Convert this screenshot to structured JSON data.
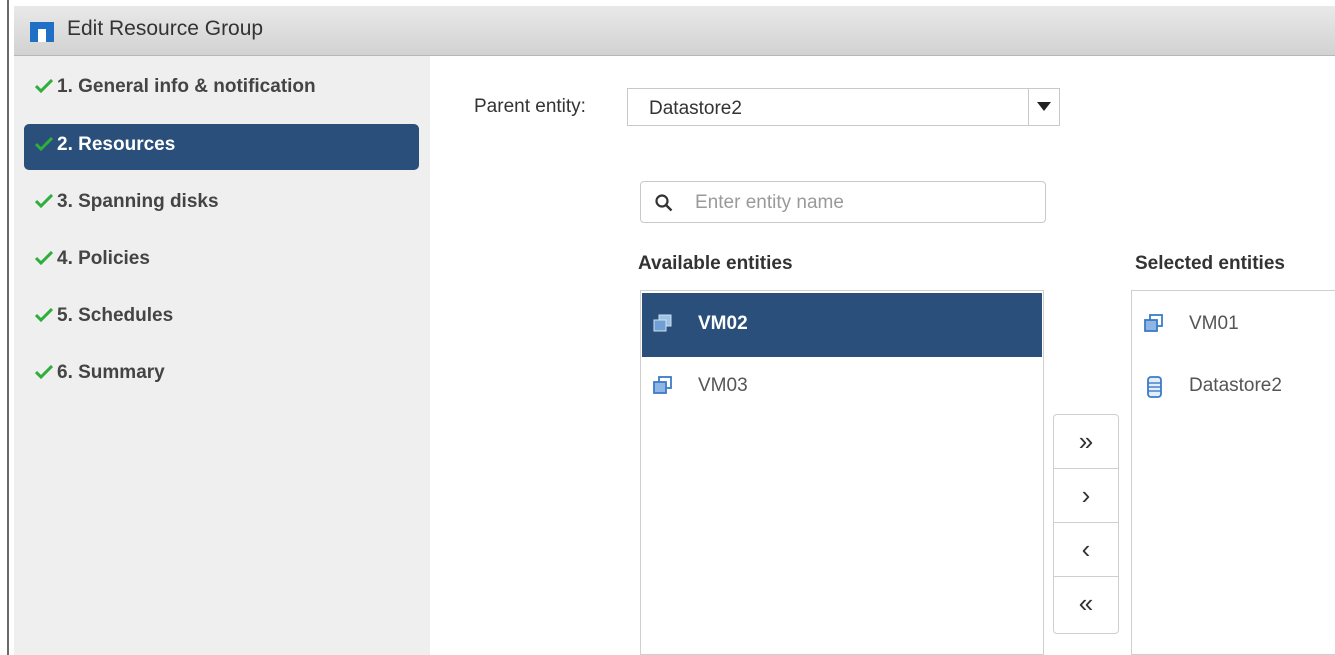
{
  "window": {
    "title": "Edit Resource Group"
  },
  "steps": [
    {
      "label": "1. General info & notification",
      "completed": true,
      "active": false
    },
    {
      "label": "2. Resources",
      "completed": true,
      "active": true
    },
    {
      "label": "3. Spanning disks",
      "completed": true,
      "active": false
    },
    {
      "label": "4. Policies",
      "completed": true,
      "active": false
    },
    {
      "label": "5. Schedules",
      "completed": true,
      "active": false
    },
    {
      "label": "6. Summary",
      "completed": true,
      "active": false
    }
  ],
  "parent_entity": {
    "label": "Parent entity:",
    "value": "Datastore2"
  },
  "search": {
    "placeholder": "Enter entity name",
    "value": ""
  },
  "available": {
    "title": "Available entities",
    "items": [
      {
        "name": "VM02",
        "icon": "vm-icon",
        "selected": true
      },
      {
        "name": "VM03",
        "icon": "vm-icon",
        "selected": false
      }
    ]
  },
  "selected": {
    "title": "Selected entities",
    "items": [
      {
        "name": "VM01",
        "icon": "vm-icon"
      },
      {
        "name": "Datastore2",
        "icon": "datastore-icon"
      }
    ]
  },
  "move_buttons": {
    "add_all": "»",
    "add": "›",
    "remove": "‹",
    "remove_all": "«"
  },
  "colors": {
    "accent": "#294f7a",
    "check": "#2eae3c",
    "sidebar_bg": "#efefef",
    "logo": "#1f6fc4"
  }
}
